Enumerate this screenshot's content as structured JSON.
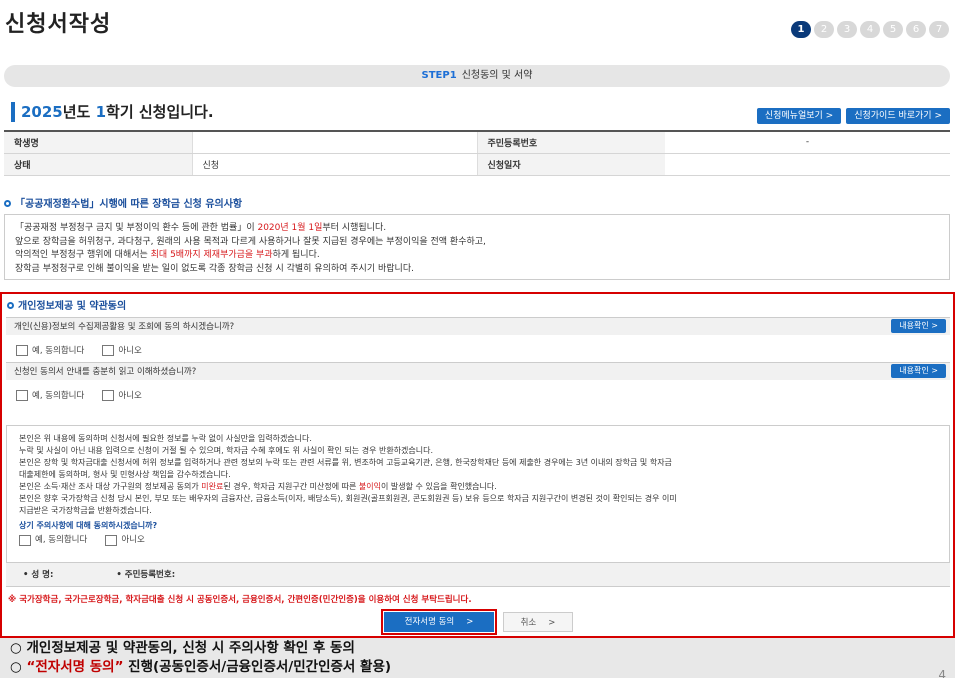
{
  "page": {
    "title": "신청서작성",
    "steps": [
      "1",
      "2",
      "3",
      "4",
      "5",
      "6",
      "7"
    ],
    "active_step": 1
  },
  "step_bar": {
    "step": "STEP1",
    "label": "신청동의 및 서약"
  },
  "semester": {
    "year": "2025",
    "year_suffix": "년도",
    "term": "1",
    "term_suffix": "학기 신청입니다."
  },
  "top_buttons": {
    "menu_video": "신청메뉴얼보기 >",
    "guide": "신청가이드 바로가기 >"
  },
  "info_table": {
    "student_name_label": "학생명",
    "student_name_value": "",
    "rrn_label": "주민등록번호",
    "rrn_value": "-",
    "status_label": "상태",
    "status_value": "신청",
    "apply_date_label": "신청일자",
    "apply_date_value": ""
  },
  "notice_section": {
    "title": "「공공재정환수법」시행에 따른 장학금 신청 유의사항",
    "lines": [
      {
        "pre": "「공공재정 부정청구 금지 및 부정이익 환수 등에 관한 법률」이 ",
        "red": "2020년 1월 1일",
        "post": "부터 시행됩니다."
      },
      {
        "pre": "앞으로 장학금을 허위청구, 과다청구, 원래의 사용 목적과 다르게 사용하거나 잘못 지급된 경우에는 부정이익을 전액 환수하고,",
        "red": "",
        "post": ""
      },
      {
        "pre": "악의적인 부정청구 행위에 대해서는 ",
        "red": "최대 5배까지 제재부가금을 부과",
        "post": "하게 됩니다."
      },
      {
        "pre": "장학금 부정청구로 인해 불이익을 받는 일이 없도록 각종 장학금 신청 시 각별히 유의하여 주시기 바랍니다.",
        "red": "",
        "post": ""
      }
    ]
  },
  "consent_section": {
    "title": "개인정보제공 및 약관동의",
    "q1": "개인(신용)정보의 수집제공활용 및 조회에 동의 하시겠습니까?",
    "q2": "신청인 동의서 안내를 충분히 읽고 이해하셨습니까?",
    "view_button": "내용확인 >",
    "agree_option": "예, 동의합니다",
    "disagree_option": "아니오",
    "pledge_lines": [
      {
        "pre": "본인은 위 내용에 동의하며 신청서에 필요한 정보를 누락 없이 사실만을 입력하겠습니다.",
        "red": "",
        "post": ""
      },
      {
        "pre": "누락 및 사실이 아닌 내용 입력으로 신청이 거절 될 수 있으며, 학자금 수혜 후에도 위 사실이 확인 되는 경우 반환하겠습니다.",
        "red": "",
        "post": ""
      },
      {
        "pre": "본인은 장학 및 학자금대출 신청서에 허위 정보를 입력하거나 관련 정보의 누락 또는 관련 서류를 위, 변조하여 고등교육기관, 은행, 한국장학재단 등에 제출한 경우에는 3년 이내의 장학금 및 학자금",
        "red": "",
        "post": ""
      },
      {
        "pre": "대출제한에 동의하며, 형사 및 민형사상 책임을 감수하겠습니다.",
        "red": "",
        "post": ""
      },
      {
        "pre": "본인은 소득·재산 조사 대상 가구원의 정보제공 동의가 ",
        "red": "미완료",
        "post": "된 경우, 학자금 지원구간 미산정에 따른 ",
        "red2": "불이익",
        "post2": "이 발생할 수 있음을 확인했습니다."
      },
      {
        "pre": "본인은 향후 국가장학금 신청 당시 본인, 부모 또는 배우자의 금융자산, 금융소득(이자, 배당소득), 회원권(골프회원권, 콘도회원권 등) 보유 등으로 학자금 지원구간이 변경된 것이 확인되는 경우 이미",
        "red": "",
        "post": ""
      },
      {
        "pre": "지급받은 국가장학금을 반환하겠습니다.",
        "red": "",
        "post": ""
      }
    ],
    "pledge_question": "상기 주의사항에 대해 동의하시겠습니까?",
    "name_label": "• 성 명:",
    "rrn_label": "• 주민등록번호:",
    "warning": "※ 국가장학금, 국가근로장학금, 학자금대출 신청 시 공동인증서, 금융인증서, 간편인증(민간인증)을 이용하여 신청 부탁드립니다.",
    "sign_button": "전자서명 동의",
    "cancel_button": "취소"
  },
  "footer": {
    "line1": "○ 개인정보제공 및 약관동의, 신청 시 주의사항 확인 후 동의",
    "line2_prefix": "○ ",
    "line2_highlight": "“전자서명 동의”",
    "line2_rest": " 진행(공동인증서/금융인증서/민간인증서 활용)"
  },
  "page_number": "4",
  "colors": {
    "accent": "#1b6ec2",
    "highlight_border": "#d60000",
    "warning": "#d7191c",
    "step_active": "#0a3a7a"
  }
}
